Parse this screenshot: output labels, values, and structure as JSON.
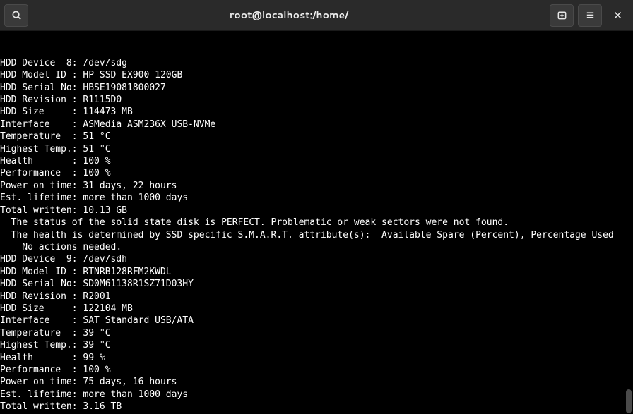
{
  "window": {
    "title": "root@localhost:/home/"
  },
  "terminal": {
    "lines": [
      "",
      "HDD Device  8: /dev/sdg",
      "HDD Model ID : HP SSD EX900 120GB",
      "HDD Serial No: HBSE19081800027",
      "HDD Revision : R1115D0",
      "HDD Size     : 114473 MB",
      "Interface    : ASMedia ASM236X USB-NVMe",
      "Temperature  : 51 °C",
      "Highest Temp.: 51 °C",
      "Health       : 100 %",
      "Performance  : 100 %",
      "Power on time: 31 days, 22 hours",
      "Est. lifetime: more than 1000 days",
      "Total written: 10.13 GB",
      "  The status of the solid state disk is PERFECT. Problematic or weak sectors were not found.",
      "  The health is determined by SSD specific S.M.A.R.T. attribute(s):  Available Spare (Percent), Percentage Used",
      "    No actions needed.",
      "",
      "HDD Device  9: /dev/sdh",
      "HDD Model ID : RTNRB128RFM2KWDL",
      "HDD Serial No: SD0M61138R1SZ71D03HY",
      "HDD Revision : R2001",
      "HDD Size     : 122104 MB",
      "Interface    : SAT Standard USB/ATA",
      "Temperature  : 39 °C",
      "Highest Temp.: 39 °C",
      "Health       : 99 %",
      "Performance  : 100 %",
      "Power on time: 75 days, 16 hours",
      "Est. lifetime: more than 1000 days",
      "Total written: 3.16 TB"
    ]
  }
}
